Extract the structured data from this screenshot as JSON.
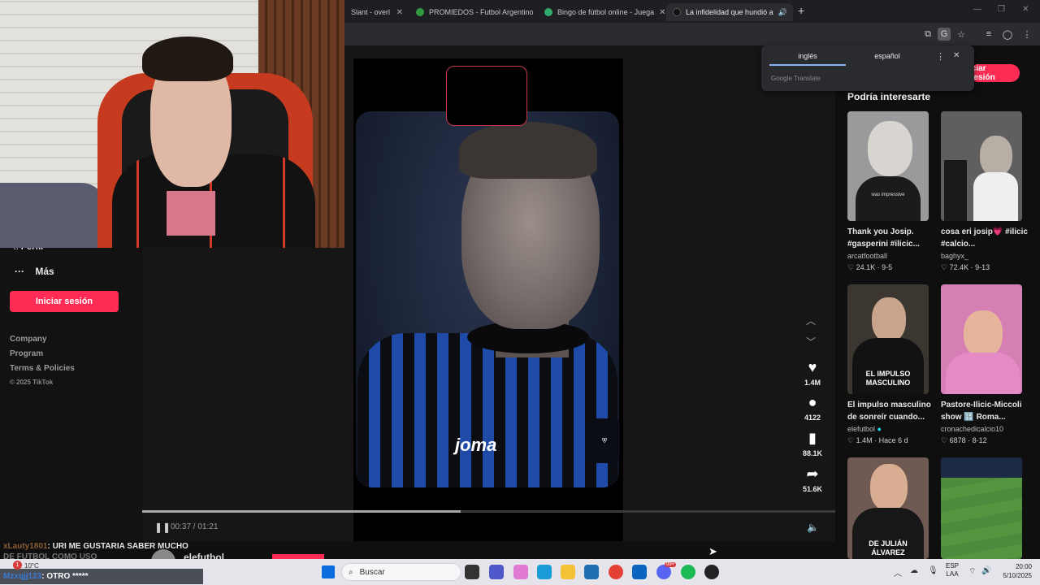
{
  "browser": {
    "tabs": [
      {
        "label": "Slant - overl",
        "color": "#3a8ee6"
      },
      {
        "label": "PROMIEDOS - Futbol Argentino",
        "color": "#2f9a3f"
      },
      {
        "label": "Bingo de fútbol online - Juega",
        "color": "#2faa6a"
      },
      {
        "label": "La infidelidad que hundió a",
        "color": "#111111"
      }
    ],
    "new_tab": "+",
    "close_glyph": "✕"
  },
  "translate_popup": {
    "lang_from": "inglés",
    "lang_to": "español",
    "brand": "Google",
    "product": "Translate"
  },
  "header": {
    "login_label": "iciar sesión"
  },
  "sidebar": {
    "profile_label": "Perfil",
    "more_label": "Más",
    "login_label": "Iniciar sesión",
    "links": [
      "Company",
      "Program",
      "Terms & Policies"
    ],
    "copyright": "© 2025 TikTok"
  },
  "video": {
    "time": "00:37 / 01:21",
    "progress_fraction": 0.46,
    "shirt_brand": "joma",
    "actions": [
      {
        "icon": "heart-icon",
        "count": "1.4M"
      },
      {
        "icon": "comment-icon",
        "count": "4122"
      },
      {
        "icon": "bookmark-icon",
        "count": "88.1K"
      },
      {
        "icon": "share-icon",
        "count": "51.6K"
      }
    ]
  },
  "suggestions": {
    "title": "Podría interesarte",
    "cards": [
      {
        "title": "Thank you Josip. #gasperini #ilicic...",
        "author": "arcatfootball",
        "likes": "24.1K",
        "date": "9-5",
        "caption": "was impressive",
        "bg": "#b4b4b4"
      },
      {
        "title": "cosa eri josip💗 #ilicic #calcio...",
        "author": "baghyx_",
        "likes": "72.4K",
        "date": "9-13",
        "caption": "",
        "bg": "#6d6d6d"
      },
      {
        "title": "El impulso masculino de sonreír cuando...",
        "author": "elefutbol",
        "likes": "1.4M",
        "date": "Hace 6 d",
        "caption": "EL IMPULSO MASCULINO",
        "bg": "#3c3631"
      },
      {
        "title": "Pastore-Ilicic-Miccoli show 🔢 Roma...",
        "author": "cronachedicalcio10",
        "likes": "6878",
        "date": "8-12",
        "caption": "",
        "bg": "#d57fb4"
      },
      {
        "title": "",
        "author": "",
        "likes": "",
        "date": "",
        "caption": "DE JULIÁN ÁLVAREZ",
        "bg": "#6e5a52"
      },
      {
        "title": "",
        "author": "",
        "likes": "",
        "date": "",
        "caption": "",
        "bg": "#4d8a3b"
      }
    ]
  },
  "chat": {
    "line1_user": "xLauty1801",
    "line1_text": ": URI ME GUSTARIA SABER MUCHO",
    "line2_text": "DE FUTBOL COMO USO",
    "line3_user": "Mzxqjj123",
    "line3_text": ": OTRO *****",
    "author_peek": "elefutbol"
  },
  "taskbar": {
    "search_placeholder": "Buscar",
    "weather_temp": "10°C",
    "lang_top": "ESP",
    "lang_bottom": "LAA",
    "time": "20:00",
    "date": "5/10/2025",
    "badge": "99+"
  }
}
